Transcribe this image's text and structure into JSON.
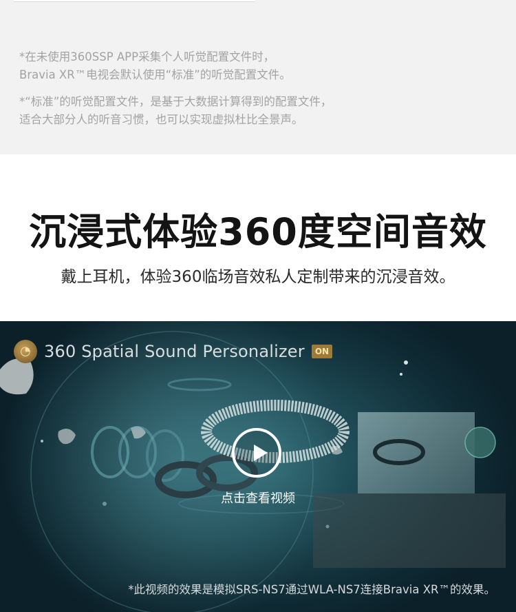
{
  "notes": {
    "note1_line1": "*在未使用360SSP APP采集个人听觉配置文件时，",
    "note1_line2": "Bravia XR™电视会默认使用“标准”的听觉配置文件。",
    "note2_line1": "*“标准”的听觉配置文件，是基于大数据计算得到的配置文件，",
    "note2_line2": "适合大部分人的听音习惯，也可以实现虚拟杜比全景声。"
  },
  "hero": {
    "title": "沉浸式体验360度空间音效",
    "subtitle": "戴上耳机，体验360临场音效私人定制带来的沉浸音效。"
  },
  "video": {
    "brand_icon": "ear-icon",
    "brand_name": "360 Spatial Sound Personalizer",
    "badge": "ON",
    "play_icon": "play-icon",
    "play_label": "点击查看视频",
    "disclaimer": "*此视频的效果是模拟SRS-NS7通过WLA-NS7连接Bravia XR™的效果。"
  },
  "colors": {
    "note_text": "#a3a3a3",
    "title_text": "#141414",
    "video_bg": "#1c4550",
    "badge_bg": "#9c7b3a"
  }
}
